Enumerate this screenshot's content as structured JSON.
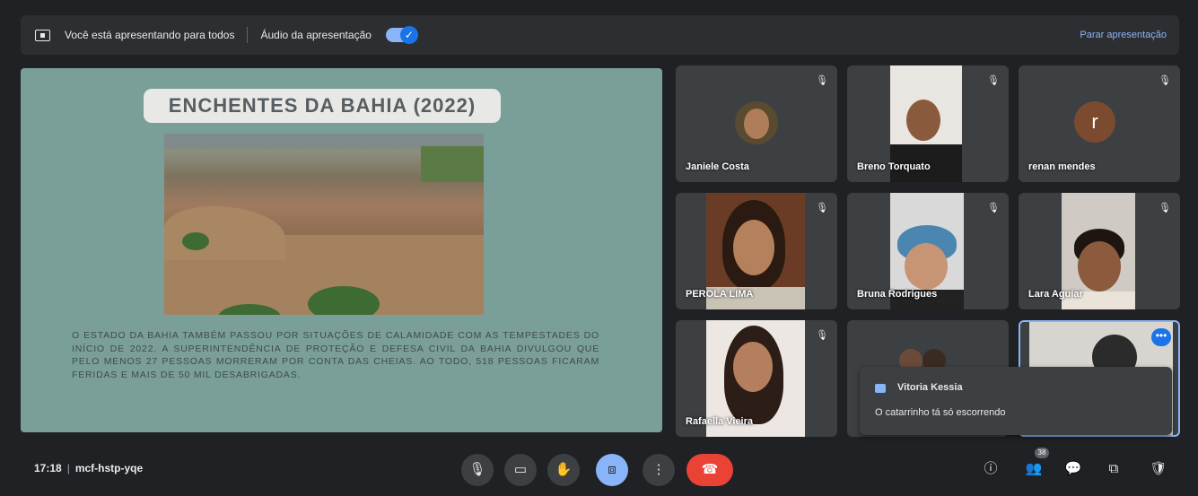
{
  "banner": {
    "presenting_text": "Você está apresentando para todos",
    "audio_label": "Áudio da apresentação",
    "stop_label": "Parar apresentação"
  },
  "slide": {
    "title": "ENCHENTES DA BAHIA (2022)",
    "body": "O ESTADO DA BAHIA TAMBÉM PASSOU POR SITUAÇÕES DE CALAMIDADE COM AS TEMPESTADES DO INÍCIO DE 2022. A SUPERINTENDÊNCIA DE PROTEÇÃO E DEFESA CIVIL DA BAHIA DIVULGOU QUE PELO MENOS 27 PESSOAS MORRERAM POR CONTA DAS CHEIAS. AO TODO, 518 PESSOAS FICARAM FERIDAS E MAIS DE 50 MIL DESABRIGADAS."
  },
  "participants": [
    {
      "name": "Janiele Costa"
    },
    {
      "name": "Breno Torquato"
    },
    {
      "name": "renan mendes",
      "initial": "r"
    },
    {
      "name": "PEROLA LIMA"
    },
    {
      "name": "Bruna Rodrigues"
    },
    {
      "name": "Lara Aguiar"
    },
    {
      "name": "Rafaella Vieira"
    }
  ],
  "chat": {
    "sender": "Vitoria Kessia",
    "message": "O catarrinho tá só escorrendo"
  },
  "bottom": {
    "time": "17:18",
    "meeting_code": "mcf-hstp-yqe",
    "people_count": "38"
  },
  "colors": {
    "background": "#202124",
    "tile": "#3c4043",
    "accent": "#8ab4f8",
    "end_call": "#ea4335"
  }
}
